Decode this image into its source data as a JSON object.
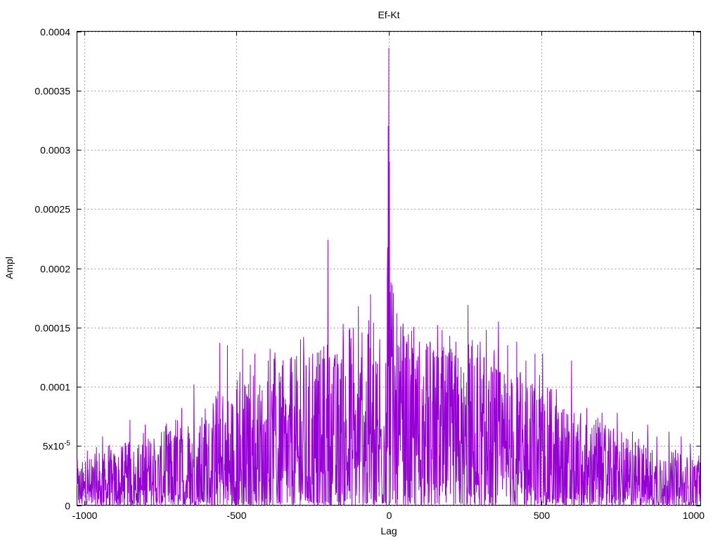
{
  "chart_data": {
    "type": "line",
    "title": "Ef-Kt",
    "xlabel": "Lag",
    "ylabel": "Ampl",
    "xlim": [
      -1024,
      1024
    ],
    "ylim": [
      0,
      0.0004
    ],
    "grid": true,
    "color": "#9400d3",
    "x_ticks": [
      {
        "value": -1000,
        "label": "-1000"
      },
      {
        "value": -500,
        "label": "-500"
      },
      {
        "value": 0,
        "label": "0"
      },
      {
        "value": 500,
        "label": "500"
      },
      {
        "value": 1000,
        "label": "1000"
      }
    ],
    "y_ticks": [
      {
        "value": 0,
        "label": "0"
      },
      {
        "value": 5e-05,
        "label": "5x10",
        "sup": "-5"
      },
      {
        "value": 0.0001,
        "label": "0.0001"
      },
      {
        "value": 0.00015,
        "label": "0.00015"
      },
      {
        "value": 0.0002,
        "label": "0.0002"
      },
      {
        "value": 0.00025,
        "label": "0.00025"
      },
      {
        "value": 0.0003,
        "label": "0.0003"
      },
      {
        "value": 0.00035,
        "label": "0.00035"
      },
      {
        "value": 0.0004,
        "label": "0.0004"
      }
    ],
    "series": [
      {
        "envelope": [
          [
            -1024,
            1.8e-05
          ],
          [
            -900,
            2.2e-05
          ],
          [
            -750,
            2.8e-05
          ],
          [
            -600,
            3.6e-05
          ],
          [
            -500,
            4.8e-05
          ],
          [
            -300,
            5.8e-05
          ],
          [
            -150,
            6.2e-05
          ],
          [
            -30,
            7e-05
          ],
          [
            0,
            0.0001
          ],
          [
            30,
            7e-05
          ],
          [
            150,
            6.2e-05
          ],
          [
            300,
            5.8e-05
          ],
          [
            500,
            4.8e-05
          ],
          [
            600,
            3.6e-05
          ],
          [
            750,
            2.8e-05
          ],
          [
            900,
            2.2e-05
          ],
          [
            1024,
            1.8e-05
          ]
        ],
        "peaks": [
          [
            -1018,
            2.5e-05
          ],
          [
            -990,
            4.6e-05
          ],
          [
            -960,
            4.9e-05
          ],
          [
            -940,
            5.8e-05
          ],
          [
            -900,
            4.2e-05
          ],
          [
            -850,
            7.2e-05
          ],
          [
            -800,
            6.8e-05
          ],
          [
            -790,
            5.6e-05
          ],
          [
            -700,
            7.2e-05
          ],
          [
            -680,
            8.2e-05
          ],
          [
            -640,
            0.000102
          ],
          [
            -600,
            7.2e-05
          ],
          [
            -555,
            0.000137
          ],
          [
            -545,
            9.2e-05
          ],
          [
            -530,
            0.000135
          ],
          [
            -500,
            9.8e-05
          ],
          [
            -480,
            0.000132
          ],
          [
            -440,
            0.000128
          ],
          [
            -420,
            8.8e-05
          ],
          [
            -390,
            0.000132
          ],
          [
            -350,
            0.000118
          ],
          [
            -320,
            0.000125
          ],
          [
            -300,
            0.000105
          ],
          [
            -290,
            0.00014
          ],
          [
            -280,
            0.000142
          ],
          [
            -250,
            0.000128
          ],
          [
            -200,
            0.000224
          ],
          [
            -195,
            0.000125
          ],
          [
            -180,
            0.000118
          ],
          [
            -150,
            0.000153
          ],
          [
            -130,
            0.000148
          ],
          [
            -100,
            0.000168
          ],
          [
            -90,
            0.000125
          ],
          [
            -60,
            0.000178
          ],
          [
            -50,
            0.000154
          ],
          [
            -30,
            0.00014
          ],
          [
            -10,
            0.00012
          ],
          [
            -5,
            0.000192
          ],
          [
            -2,
            0.00032
          ],
          [
            0,
            0.000386
          ],
          [
            2,
            0.00029
          ],
          [
            4,
            0.00018
          ],
          [
            8,
            0.000125
          ],
          [
            20,
            0.000118
          ],
          [
            40,
            0.00012
          ],
          [
            60,
            0.000135
          ],
          [
            80,
            0.000128
          ],
          [
            100,
            0.000138
          ],
          [
            160,
            0.000152
          ],
          [
            175,
            0.000148
          ],
          [
            200,
            0.000143
          ],
          [
            220,
            0.000138
          ],
          [
            260,
            0.000169
          ],
          [
            300,
            0.000138
          ],
          [
            320,
            0.000148
          ],
          [
            360,
            0.000155
          ],
          [
            390,
            0.000135
          ],
          [
            420,
            0.000138
          ],
          [
            450,
            0.000122
          ],
          [
            480,
            0.000128
          ],
          [
            505,
            0.000128
          ],
          [
            530,
            9.8e-05
          ],
          [
            550,
            9.8e-05
          ],
          [
            600,
            0.000122
          ],
          [
            650,
            8.2e-05
          ],
          [
            680,
            7.2e-05
          ],
          [
            700,
            7.8e-05
          ],
          [
            750,
            7.8e-05
          ],
          [
            800,
            6.2e-05
          ],
          [
            820,
            5.6e-05
          ],
          [
            850,
            6.8e-05
          ],
          [
            880,
            5.8e-05
          ],
          [
            920,
            6.2e-05
          ],
          [
            960,
            5.8e-05
          ],
          [
            990,
            5.2e-05
          ],
          [
            1018,
            4.2e-05
          ]
        ]
      }
    ]
  }
}
